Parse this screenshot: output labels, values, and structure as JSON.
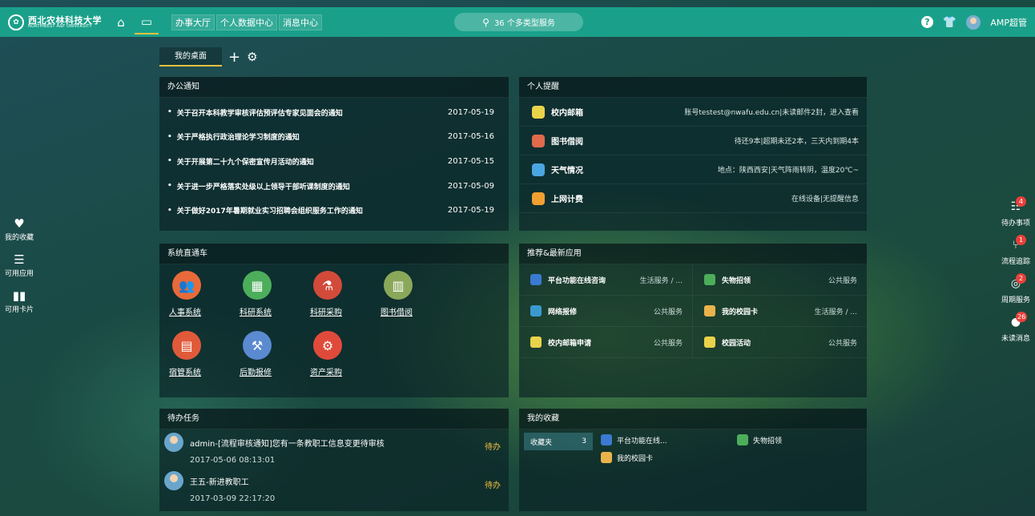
{
  "topbar": {
    "logo_cn": "西北农林科技大学",
    "logo_en": "NORTHWEST A&F UNIVERSITY",
    "nav": [
      "办事大厅",
      "个人数据中心",
      "消息中心"
    ],
    "search_text": "36 个多类型服务",
    "user_name": "AMP超管",
    "bg_color": "#1aa08a"
  },
  "desk": {
    "tab_label": "我的桌面"
  },
  "notice": {
    "title": "办公通知",
    "items": [
      {
        "title": "关于召开本科教学审核评估预评估专家见面会的通知",
        "date": "2017-05-19"
      },
      {
        "title": "关于严格执行政治理论学习制度的通知",
        "date": "2017-05-16"
      },
      {
        "title": "关于开展第二十九个保密宣传月活动的通知",
        "date": "2017-05-15"
      },
      {
        "title": "关于进一步严格落实处级以上领导干部听课制度的通知",
        "date": "2017-05-09"
      },
      {
        "title": "关于做好2017年暑期就业实习招聘会组织服务工作的通知",
        "date": "2017-05-19"
      }
    ]
  },
  "remind": {
    "title": "个人提醒",
    "items": [
      {
        "name": "校内邮箱",
        "value": "账号testest@nwafu.edu.cn|未读邮件2封，进入查看",
        "icon": "mail-icon",
        "color": "#e9d34a"
      },
      {
        "name": "图书借阅",
        "value": "待还9本|超期未还2本，三天内到期4本",
        "icon": "book-icon",
        "color": "#e06a4a"
      },
      {
        "name": "天气情况",
        "value": "地点：陕西西安|天气阵雨转阴，温度20℃~",
        "icon": "cloud-icon",
        "color": "#4aa6e0"
      },
      {
        "name": "上网计费",
        "value": "在线设备|无提醒信息",
        "icon": "network-icon",
        "color": "#f0a030"
      }
    ]
  },
  "systems": {
    "title": "系统直通车",
    "items": [
      {
        "label": "人事系统",
        "icon": "people-icon",
        "color": "#e86a3a",
        "glyph": "👥"
      },
      {
        "label": "科研系统",
        "icon": "screen-icon",
        "color": "#4cae5a",
        "glyph": "▦"
      },
      {
        "label": "科研采购",
        "icon": "microscope-icon",
        "color": "#d24a3a",
        "glyph": "⚗"
      },
      {
        "label": "图书借阅",
        "icon": "books-icon",
        "color": "#8aa85a",
        "glyph": "▥"
      },
      {
        "label": "宿管系统",
        "icon": "building-icon",
        "color": "#e05a3a",
        "glyph": "▤"
      },
      {
        "label": "后勤报修",
        "icon": "repair-icon",
        "color": "#5a8ad0",
        "glyph": "⚒"
      },
      {
        "label": "资产采购",
        "icon": "asset-icon",
        "color": "#e04a3a",
        "glyph": "⚙"
      }
    ]
  },
  "apps": {
    "title": "推荐&最新应用",
    "items": [
      {
        "name": "平台功能在线咨询",
        "category": "生活服务 / ...",
        "icon": "chat-icon",
        "color": "#3a7ad0"
      },
      {
        "name": "失物招领",
        "category": "公共服务",
        "icon": "lostfound-icon",
        "color": "#4cae5a"
      },
      {
        "name": "网络报修",
        "category": "公共服务",
        "icon": "wrench-icon",
        "color": "#3a9ad0"
      },
      {
        "name": "我的校园卡",
        "category": "生活服务 / ...",
        "icon": "card-icon",
        "color": "#e9b34a"
      },
      {
        "name": "校内邮箱申请",
        "category": "公共服务",
        "icon": "mail-icon",
        "color": "#e9d34a"
      },
      {
        "name": "校园活动",
        "category": "公共服务",
        "icon": "activity-icon",
        "color": "#e9d34a"
      }
    ]
  },
  "todo": {
    "title": "待办任务",
    "items": [
      {
        "title": "admin-[流程审核通知]您有一条教职工信息变更待审核",
        "time": "2017-05-06 08:13:01",
        "status": "待办"
      },
      {
        "title": "王五-新进教职工",
        "time": "2017-03-09 22:17:20",
        "status": "待办"
      }
    ]
  },
  "favorites": {
    "title": "我的收藏",
    "folder_label": "收藏夹",
    "folder_count": "3",
    "items": [
      {
        "name": "平台功能在线...",
        "icon": "chat-icon",
        "color": "#3a7ad0"
      },
      {
        "name": "失物招领",
        "icon": "lostfound-icon",
        "color": "#4cae5a"
      },
      {
        "name": "我的校园卡",
        "icon": "card-icon",
        "color": "#e9b34a"
      }
    ]
  },
  "left_bar": [
    {
      "label": "我的收藏",
      "icon": "heart-icon",
      "glyph": "♥"
    },
    {
      "label": "可用应用",
      "icon": "list-icon",
      "glyph": "☰"
    },
    {
      "label": "可用卡片",
      "icon": "columns-icon",
      "glyph": "▮▮"
    }
  ],
  "right_bar": [
    {
      "label": "待办事项",
      "icon": "tasklist-icon",
      "badge": "4",
      "glyph": "☷"
    },
    {
      "label": "流程追踪",
      "icon": "flow-icon",
      "badge": "1",
      "glyph": "⑂"
    },
    {
      "label": "周期服务",
      "icon": "cycle-check-icon",
      "badge": "2",
      "glyph": "◎"
    },
    {
      "label": "未读消息",
      "icon": "message-icon",
      "badge": "26",
      "glyph": "●"
    }
  ]
}
